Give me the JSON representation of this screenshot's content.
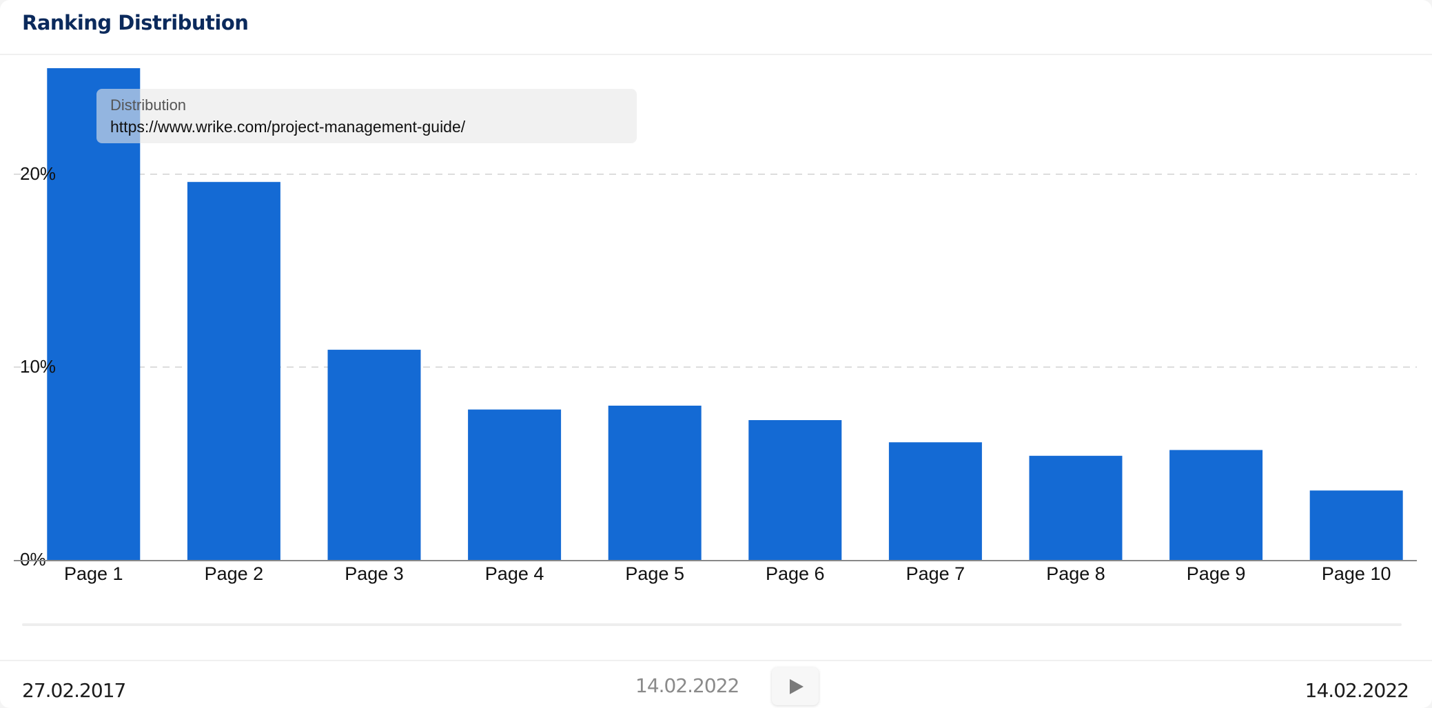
{
  "header": {
    "title": "Ranking Distribution"
  },
  "tooltip": {
    "label": "Distribution",
    "value": "https://www.wrike.com/project-management-guide/"
  },
  "colors": {
    "bar": "#146AD4",
    "gridline": "#dddddd",
    "axis": "#888888",
    "title": "#0b2a5c"
  },
  "timeline": {
    "start_date": "27.02.2017",
    "current_date": "14.02.2022",
    "end_date": "14.02.2022",
    "play_icon": "play-icon"
  },
  "chart_data": {
    "type": "bar",
    "title": "Ranking Distribution",
    "xlabel": "",
    "ylabel": "",
    "categories": [
      "Page 1",
      "Page 2",
      "Page 3",
      "Page 4",
      "Page 5",
      "Page 6",
      "Page 7",
      "Page 8",
      "Page 9",
      "Page 10"
    ],
    "values": [
      25.5,
      19.6,
      10.9,
      7.8,
      8.0,
      7.25,
      6.1,
      5.4,
      5.7,
      3.6
    ],
    "unit": "%",
    "ylim": [
      0,
      25.7
    ],
    "yticks": [
      0,
      10,
      20
    ],
    "ytick_labels": [
      "0%",
      "10%",
      "20%"
    ],
    "grid": true,
    "legend": "none"
  }
}
